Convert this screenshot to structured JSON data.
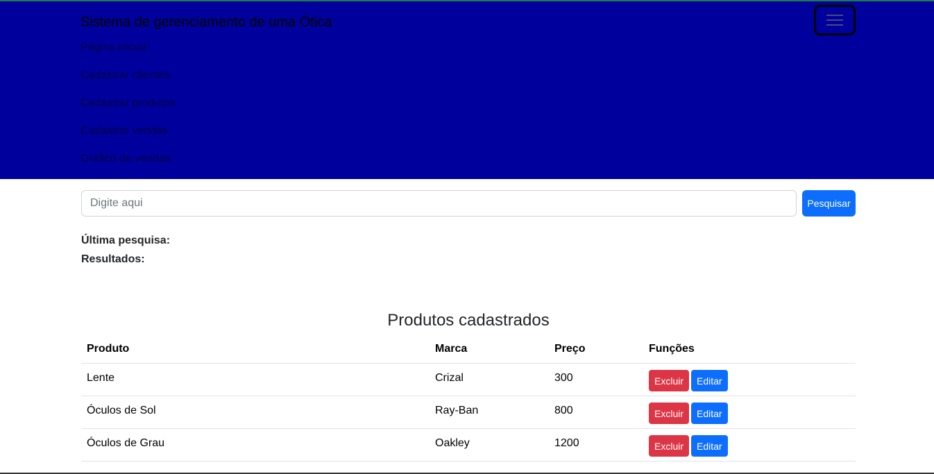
{
  "navbar": {
    "brand": "Sistema de gerenciamento de uma Ótica",
    "items": [
      {
        "label": "Página inicial"
      },
      {
        "label": "Cadastrar clientes"
      },
      {
        "label": "Cadastrar produtos"
      },
      {
        "label": "Cadastrar vendas"
      },
      {
        "label": "Gráfico de vendas"
      }
    ],
    "toggler_icon": "hamburger-icon",
    "bg_color": "#00009d"
  },
  "search": {
    "placeholder": "Digite aqui",
    "button_label": "Pesquisar",
    "last_search_label": "Última pesquisa:",
    "results_label": "Resultados:"
  },
  "products": {
    "title": "Produtos cadastrados",
    "columns": [
      "Produto",
      "Marca",
      "Preço",
      "Funções"
    ],
    "rows": [
      {
        "produto": "Lente",
        "marca": "Crizal",
        "preco": "300"
      },
      {
        "produto": "Óculos de Sol",
        "marca": "Ray-Ban",
        "preco": "800"
      },
      {
        "produto": "Óculos de Grau",
        "marca": "Oakley",
        "preco": "1200"
      }
    ],
    "delete_label": "Excluir",
    "edit_label": "Editar",
    "colors": {
      "delete": "#dc3545",
      "edit": "#0d6efd"
    }
  }
}
